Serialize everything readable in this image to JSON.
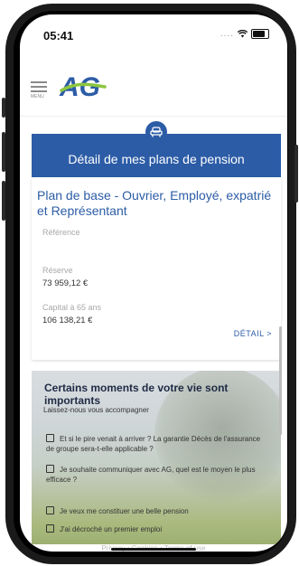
{
  "status_bar": {
    "time": "05:41",
    "signal_dots": "...."
  },
  "header": {
    "menu_label": "MENU",
    "logo_text": "AG"
  },
  "pension_card": {
    "title": "Détail de mes plans de pension",
    "plan_title": "Plan de base - Ouvrier, Employé, expatrié et Représentant",
    "reference_label": "Référence",
    "reserve_label": "Réserve",
    "reserve_value": "73 959,12 €",
    "capital_label": "Capital à 65 ans",
    "capital_value": "106 138,21 €",
    "detail_button": "DÉTAIL  >"
  },
  "moments": {
    "title": "Certains moments de votre vie sont importants",
    "subtitle": "Laissez-nous vous accompagner",
    "items": [
      "Et si le pire venait à arriver ? La garantie Décès de l'assurance de groupe sera-t-elle applicable ?",
      "Je souhaite communiquer avec AG, quel est le moyen le plus efficace ?",
      "Je veux me constituer une belle pension",
      "J'ai décroché un premier emploi"
    ]
  },
  "footer": {
    "links": "Privacy  •  Cookies  •  Terms of use"
  },
  "colors": {
    "brand_blue": "#2c5ca6",
    "logo_green": "#8cc63f"
  }
}
